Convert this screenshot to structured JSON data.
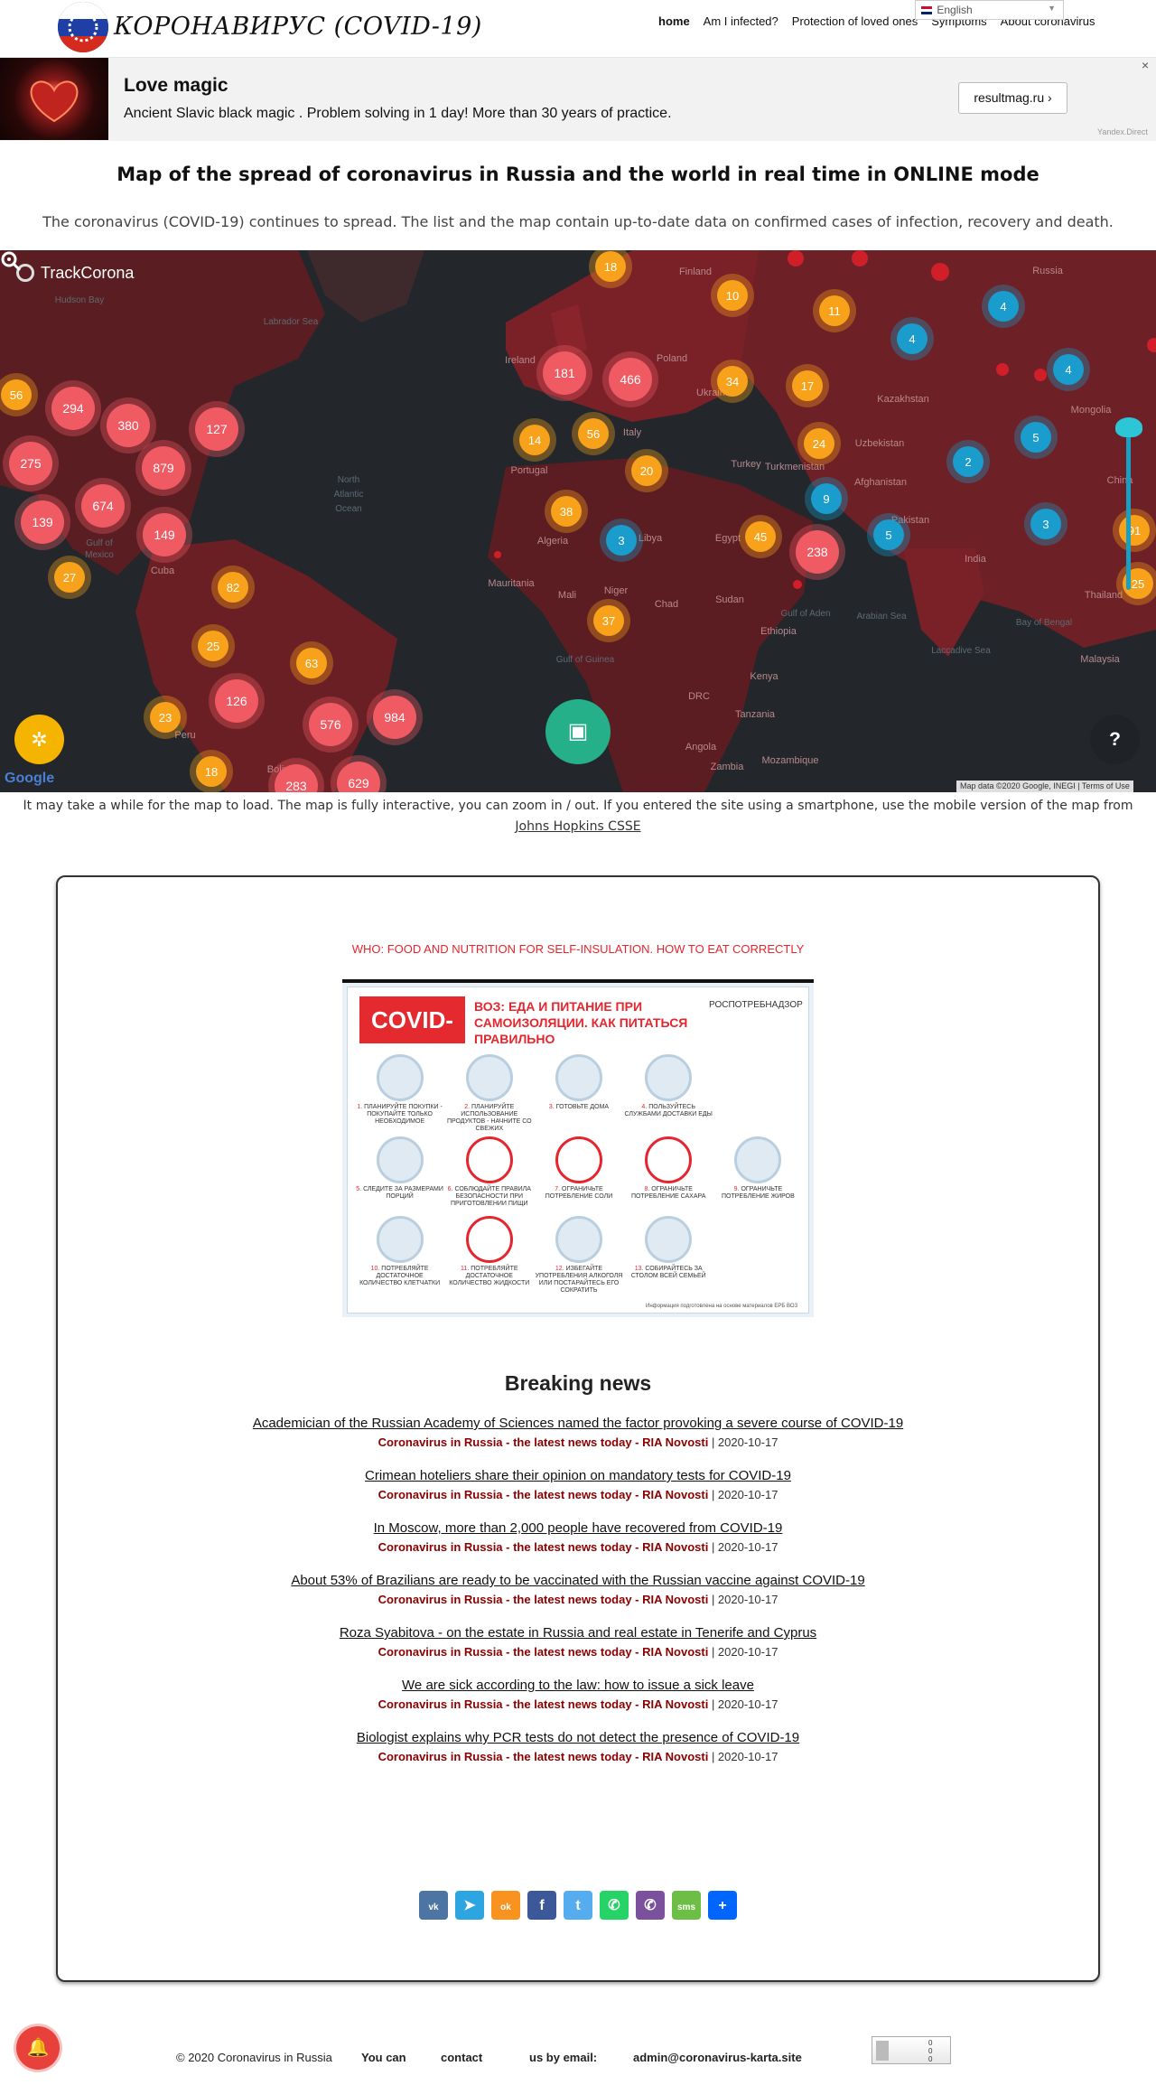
{
  "header": {
    "logo_text": "КОРОНАВИРУС (COVID-19)",
    "nav": [
      "home",
      "Am I infected?",
      "Protection of loved ones",
      "Symptoms",
      "About coronavirus"
    ],
    "language": "English"
  },
  "ad": {
    "title": "Love magic",
    "text": "Ancient Slavic black magic . Problem solving in 1 day! More than 30 years of practice.",
    "button": "resultmag.ru",
    "close": "×",
    "source": "Yandex.Direct"
  },
  "page": {
    "title": "Map of the spread of coronavirus in Russia and the world in real time in ONLINE mode",
    "intro": "The coronavirus (COVID-19) continues to spread. The list and the map contain up-to-date data on confirmed cases of infection, recovery and death."
  },
  "map": {
    "brand": "TrackCorona",
    "google": "Google",
    "attribution": "Map data ©2020 Google, INEGI  |  Terms of Use",
    "help": "?",
    "labels": [
      {
        "text": "Hudson Bay",
        "cls": "water"
      },
      {
        "text": "Labrador Sea",
        "cls": "water"
      },
      {
        "text": "North",
        "cls": "water"
      },
      {
        "text": "Atlantic",
        "cls": "water"
      },
      {
        "text": "Ocean",
        "cls": "water"
      },
      {
        "text": "Gulf of",
        "cls": "water"
      },
      {
        "text": "Mexico",
        "cls": "water"
      },
      {
        "text": "Finland",
        "cls": "land"
      },
      {
        "text": "Russia",
        "cls": "land"
      },
      {
        "text": "Kazakhstan",
        "cls": "land"
      },
      {
        "text": "Mongolia",
        "cls": "land"
      },
      {
        "text": "Turkey",
        "cls": "land"
      },
      {
        "text": "Turkmenistan",
        "cls": "land"
      },
      {
        "text": "Afghanistan",
        "cls": "land"
      },
      {
        "text": "Pakistan",
        "cls": "land"
      },
      {
        "text": "India",
        "cls": "land"
      },
      {
        "text": "China",
        "cls": "land"
      },
      {
        "text": "Libya",
        "cls": "land"
      },
      {
        "text": "Egypt",
        "cls": "land"
      },
      {
        "text": "Chad",
        "cls": "land"
      },
      {
        "text": "Sudan",
        "cls": "land"
      },
      {
        "text": "Ethiopia",
        "cls": "land"
      },
      {
        "text": "Kenya",
        "cls": "land"
      },
      {
        "text": "Tanzania",
        "cls": "land"
      },
      {
        "text": "DRC",
        "cls": "land"
      },
      {
        "text": "Angola",
        "cls": "land"
      },
      {
        "text": "Mozambique",
        "cls": "land"
      },
      {
        "text": "Zambia",
        "cls": "land"
      },
      {
        "text": "Mali",
        "cls": "land"
      },
      {
        "text": "Niger",
        "cls": "land"
      },
      {
        "text": "Mauritania",
        "cls": "land"
      },
      {
        "text": "Algeria",
        "cls": "land"
      },
      {
        "text": "Poland",
        "cls": "land"
      },
      {
        "text": "Ukraine",
        "cls": "land"
      },
      {
        "text": "Italy",
        "cls": "land"
      },
      {
        "text": "Portugal",
        "cls": "land"
      },
      {
        "text": "Thailand",
        "cls": "land"
      },
      {
        "text": "Malaysia",
        "cls": "land"
      },
      {
        "text": "Cuba",
        "cls": "land"
      },
      {
        "text": "Peru",
        "cls": "land"
      },
      {
        "text": "Bolivia",
        "cls": "land"
      },
      {
        "text": "Ireland",
        "cls": "land"
      },
      {
        "text": "Uzbekistan",
        "cls": "land"
      },
      {
        "text": "Bay of Bengal",
        "cls": "water"
      },
      {
        "text": "Laccadive Sea",
        "cls": "water"
      },
      {
        "text": "Arabian Sea",
        "cls": "water"
      },
      {
        "text": "Gulf of Guinea",
        "cls": "water"
      },
      {
        "text": "Gulf of Aden",
        "cls": "water"
      }
    ],
    "clusters": [
      {
        "v": "18",
        "c": "orange"
      },
      {
        "v": "10",
        "c": "orange"
      },
      {
        "v": "11",
        "c": "orange"
      },
      {
        "v": "4",
        "c": "blue"
      },
      {
        "v": "4",
        "c": "blue"
      },
      {
        "v": "4",
        "c": "blue"
      },
      {
        "v": "181",
        "c": "red"
      },
      {
        "v": "466",
        "c": "red"
      },
      {
        "v": "34",
        "c": "orange"
      },
      {
        "v": "17",
        "c": "orange"
      },
      {
        "v": "56",
        "c": "orange"
      },
      {
        "v": "294",
        "c": "red"
      },
      {
        "v": "380",
        "c": "red"
      },
      {
        "v": "127",
        "c": "red"
      },
      {
        "v": "14",
        "c": "orange"
      },
      {
        "v": "56",
        "c": "orange"
      },
      {
        "v": "24",
        "c": "orange"
      },
      {
        "v": "5",
        "c": "blue"
      },
      {
        "v": "275",
        "c": "red"
      },
      {
        "v": "879",
        "c": "red"
      },
      {
        "v": "20",
        "c": "orange"
      },
      {
        "v": "2",
        "c": "blue"
      },
      {
        "v": "674",
        "c": "red"
      },
      {
        "v": "9",
        "c": "blue"
      },
      {
        "v": "139",
        "c": "red"
      },
      {
        "v": "38",
        "c": "orange"
      },
      {
        "v": "149",
        "c": "red"
      },
      {
        "v": "3",
        "c": "blue"
      },
      {
        "v": "45",
        "c": "orange"
      },
      {
        "v": "238",
        "c": "red"
      },
      {
        "v": "5",
        "c": "blue"
      },
      {
        "v": "3",
        "c": "blue"
      },
      {
        "v": "27",
        "c": "orange"
      },
      {
        "v": "82",
        "c": "orange"
      },
      {
        "v": "37",
        "c": "orange"
      },
      {
        "v": "25",
        "c": "orange"
      },
      {
        "v": "63",
        "c": "orange"
      },
      {
        "v": "126",
        "c": "red"
      },
      {
        "v": "23",
        "c": "orange"
      },
      {
        "v": "576",
        "c": "red"
      },
      {
        "v": "984",
        "c": "red"
      },
      {
        "v": "18",
        "c": "orange"
      },
      {
        "v": "283",
        "c": "red"
      },
      {
        "v": "629",
        "c": "red"
      },
      {
        "v": "25",
        "c": "orange"
      },
      {
        "v": "91",
        "c": "orange"
      }
    ]
  },
  "map_note": {
    "text": "It may take a while for the map to load. The map is fully interactive, you can zoom in / out. If you entered the site using a smartphone, use the mobile version of the map from ",
    "link": "Johns Hopkins CSSE"
  },
  "who": {
    "heading": "WHO: FOOD AND NUTRITION FOR SELF-INSULATION. HOW TO EAT CORRECTLY",
    "badge": "COVID-19",
    "title": "ВОЗ: ЕДА И ПИТАНИЕ ПРИ САМОИЗОЛЯЦИИ. КАК ПИТАТЬСЯ ПРАВИЛЬНО",
    "agency": "РОСПОТРЕБНАДЗОР",
    "items": [
      {
        "n": "1.",
        "t": "ПЛАНИРУЙТЕ ПОКУПКИ - ПОКУПАЙТЕ ТОЛЬКО НЕОБХОДИМОЕ"
      },
      {
        "n": "2.",
        "t": "ПЛАНИРУЙТЕ ИСПОЛЬЗОВАНИЕ ПРОДУКТОВ - НАЧНИТЕ СО СВЕЖИХ"
      },
      {
        "n": "3.",
        "t": "ГОТОВЬТЕ ДОМА"
      },
      {
        "n": "4.",
        "t": "ПОЛЬЗУЙТЕСЬ СЛУЖБАМИ ДОСТАВКИ ЕДЫ"
      },
      {
        "n": "",
        "t": ""
      },
      {
        "n": "5.",
        "t": "СЛЕДИТЕ ЗА РАЗМЕРАМИ ПОРЦИЙ"
      },
      {
        "n": "6.",
        "t": "СОБЛЮДАЙТЕ ПРАВИЛА БЕЗОПАСНОСТИ ПРИ ПРИГОТОВЛЕНИИ ПИЩИ"
      },
      {
        "n": "7.",
        "t": "ОГРАНИЧЬТЕ ПОТРЕБЛЕНИЕ СОЛИ"
      },
      {
        "n": "8.",
        "t": "ОГРАНИЧЬТЕ ПОТРЕБЛЕНИЕ САХАРА"
      },
      {
        "n": "9.",
        "t": "ОГРАНИЧЬТЕ ПОТРЕБЛЕНИЕ ЖИРОВ"
      },
      {
        "n": "10.",
        "t": "ПОТРЕБЛЯЙТЕ ДОСТАТОЧНОЕ КОЛИЧЕСТВО КЛЕТЧАТКИ"
      },
      {
        "n": "11.",
        "t": "ПОТРЕБЛЯЙТЕ ДОСТАТОЧНОЕ КОЛИЧЕСТВО ЖИДКОСТИ"
      },
      {
        "n": "12.",
        "t": "ИЗБЕГАЙТЕ УПОТРЕБЛЕНИЯ АЛКОГОЛЯ ИЛИ ПОСТАРАЙТЕСЬ ЕГО СОКРАТИТЬ"
      },
      {
        "n": "13.",
        "t": "СОБИРАЙТЕСЬ ЗА СТОЛОМ ВСЕЙ СЕМЬЕЙ"
      },
      {
        "n": "",
        "t": ""
      }
    ],
    "footnote": "Информация подготовлена на основе материалов ЕРБ ВОЗ"
  },
  "news": {
    "heading": "Breaking news",
    "items": [
      {
        "title": "Academician of the Russian Academy of Sciences named the factor provoking a severe course of COVID-19",
        "source": "Coronavirus in Russia - the latest news today - RIA Novosti",
        "date": " | 2020-10-17"
      },
      {
        "title": "Crimean hoteliers share their opinion on mandatory tests for COVID-19",
        "source": "Coronavirus in Russia - the latest news today - RIA Novosti",
        "date": " | 2020-10-17"
      },
      {
        "title": "In Moscow, more than 2,000 people have recovered from COVID-19",
        "source": "Coronavirus in Russia - the latest news today - RIA Novosti",
        "date": " | 2020-10-17"
      },
      {
        "title": "About 53% of Brazilians are ready to be vaccinated with the Russian vaccine against COVID-19",
        "source": "Coronavirus in Russia - the latest news today - RIA Novosti",
        "date": " | 2020-10-17"
      },
      {
        "title": "Roza Syabitova - on the estate in Russia and real estate in Tenerife and Cyprus",
        "source": "Coronavirus in Russia - the latest news today - RIA Novosti",
        "date": " | 2020-10-17"
      },
      {
        "title": "We are sick according to the law: how to issue a sick leave",
        "source": "Coronavirus in Russia - the latest news today - RIA Novosti",
        "date": " | 2020-10-17"
      },
      {
        "title": "Biologist explains why PCR tests do not detect the presence of COVID-19",
        "source": "Coronavirus in Russia - the latest news today - RIA Novosti",
        "date": " | 2020-10-17"
      }
    ]
  },
  "share": [
    {
      "name": "vk",
      "glyph": "vk",
      "color": "#4c75a3"
    },
    {
      "name": "telegram",
      "glyph": "➤",
      "color": "#2ca5e0"
    },
    {
      "name": "odnoklassniki",
      "glyph": "ok",
      "color": "#f7931e"
    },
    {
      "name": "facebook",
      "glyph": "f",
      "color": "#3b5998"
    },
    {
      "name": "twitter",
      "glyph": "t",
      "color": "#55acee"
    },
    {
      "name": "whatsapp",
      "glyph": "✆",
      "color": "#25d366"
    },
    {
      "name": "viber",
      "glyph": "✆",
      "color": "#7b519d"
    },
    {
      "name": "sms",
      "glyph": "sms",
      "color": "#6cbe45"
    },
    {
      "name": "more",
      "glyph": "+",
      "color": "#0166ff"
    }
  ],
  "footer": {
    "copyright": "© 2020 Coronavirus in Russia",
    "p1": "You can",
    "p2": "contact",
    "p3": "us by email:",
    "email": "admin@coronavirus-karta.site"
  },
  "colors": {
    "accent_red": "#e5262e",
    "news_source": "#8b0000",
    "map_bg": "#23272b"
  }
}
